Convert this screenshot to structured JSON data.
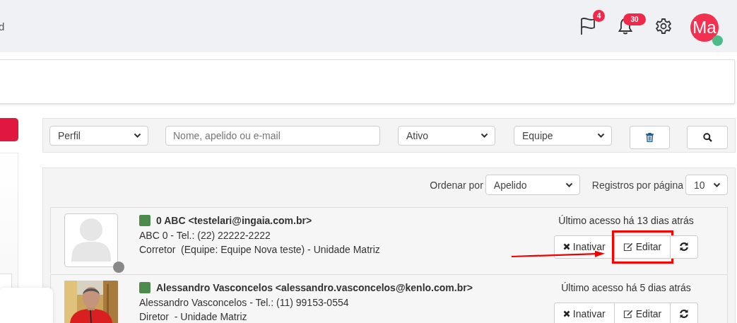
{
  "header": {
    "title_fragment": "d",
    "flags": {
      "badge": "4"
    },
    "notifications": {
      "badge": "30"
    },
    "user": {
      "initials": "Ma",
      "online": true
    }
  },
  "filters": {
    "profile": {
      "value": "Perfil"
    },
    "search": {
      "placeholder": "Nome, apelido ou e-mail"
    },
    "status": {
      "value": "Ativo"
    },
    "team": {
      "value": "Equipe"
    }
  },
  "list": {
    "sort_label": "Ordenar por",
    "sort": {
      "value": "Apelido"
    },
    "per_page_label": "Registros por página",
    "per_page": {
      "value": "10"
    },
    "users": [
      {
        "avatar": {
          "kind": "placeholder"
        },
        "status_dot": {
          "color": "#888888"
        },
        "color": "#4b8b4b",
        "title": "0 ABC <testelari@ingaia.com.br>",
        "line_2": "ABC 0 - Tel.: (22) 22222-2222",
        "line_3": "Corretor  (Equipe: Equipe Nova teste) - Unidade Matriz",
        "last_access": "Último acesso há 13 dias atrás",
        "buttons": [
          {
            "kind": "deactivate",
            "label": "Inativar",
            "highlighted": false
          },
          {
            "kind": "edit",
            "label": "Editar",
            "highlighted": true
          },
          {
            "kind": "refresh",
            "highlighted": false
          }
        ]
      },
      {
        "color": "#4b8b4b",
        "title": "Alessandro Vasconcelos <alessandro.vasconcelos@kenlo.com.br>",
        "line_2": "Alessandro Vasconcelos - Tel.: (11) 99153-0554",
        "line_3": "Diretor  - Unidade Matriz",
        "last_access": "Último acesso há 5 dias atrás",
        "buttons": [
          {
            "kind": "deactivate",
            "label": "Inativar",
            "highlighted": false
          },
          {
            "kind": "edit",
            "label": "Editar",
            "highlighted": false
          },
          {
            "kind": "refresh",
            "highlighted": false
          }
        ]
      }
    ]
  }
}
